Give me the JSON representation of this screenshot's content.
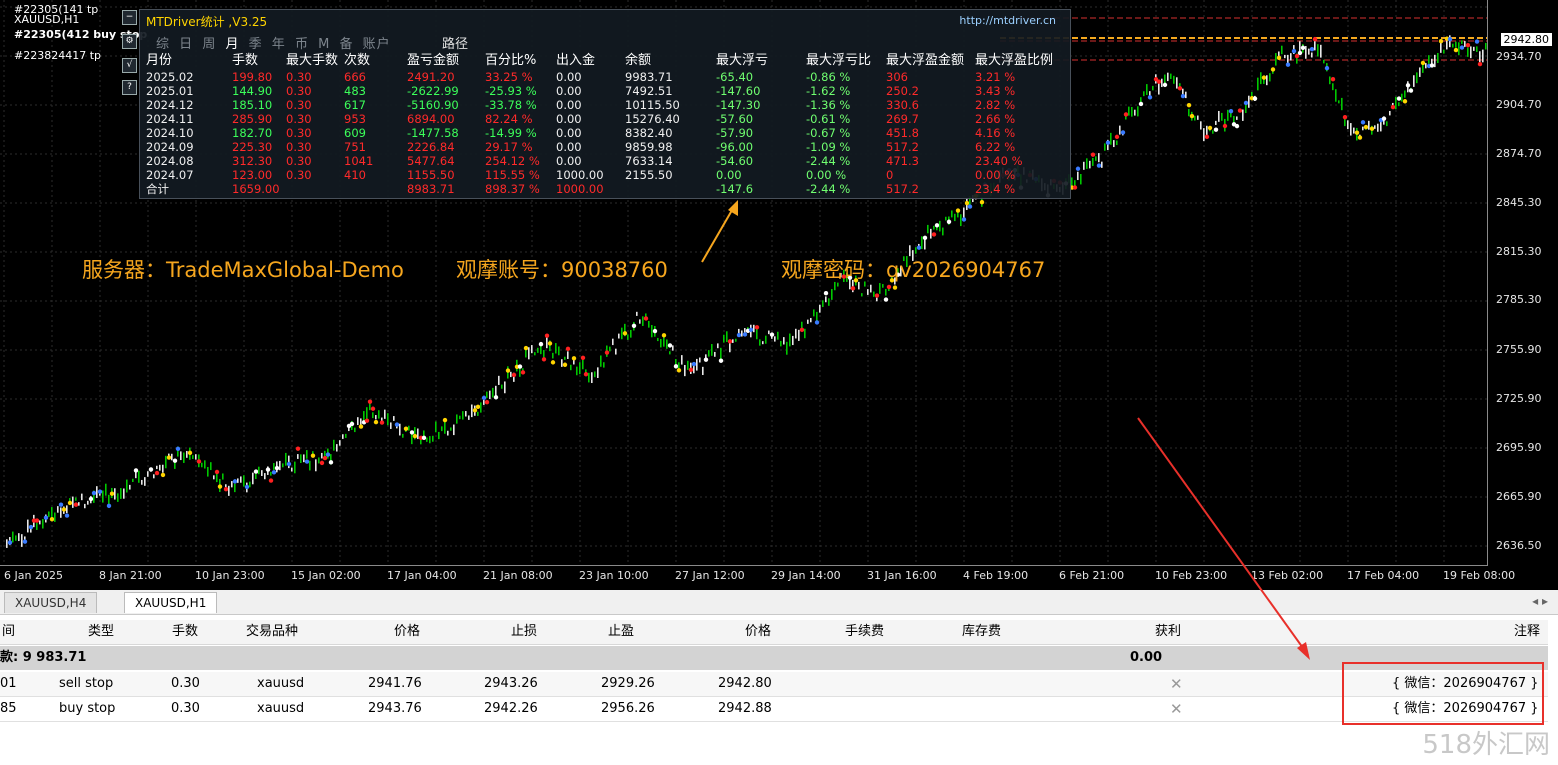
{
  "chart": {
    "symbol_labels": [
      "#22305(141 tp",
      "XAUUSD,H1",
      "#22305(412 buy stop",
      "#223824417 tp"
    ],
    "price_ticks": [
      "2934.70",
      "2904.70",
      "2874.70",
      "2845.30",
      "2815.30",
      "2785.30",
      "2755.90",
      "2725.90",
      "2695.90",
      "2665.90",
      "2636.50"
    ],
    "current_price": "2942.80",
    "time_ticks": [
      "6 Jan 2025",
      "8 Jan 21:00",
      "10 Jan 23:00",
      "15 Jan 02:00",
      "17 Jan 04:00",
      "21 Jan 08:00",
      "23 Jan 10:00",
      "27 Jan 12:00",
      "29 Jan 14:00",
      "31 Jan 16:00",
      "4 Feb 19:00",
      "6 Feb 21:00",
      "10 Feb 23:00",
      "13 Feb 02:00",
      "17 Feb 04:00",
      "19 Feb 08:00"
    ],
    "overlay": {
      "server": "服务器：TradeMaxGlobal-Demo",
      "account": "观摩账号：90038760",
      "password": "观摩密码：qv2026904767"
    },
    "colors": {
      "up": "#00c800",
      "down": "#ff2020",
      "level_red": "#d62f2f",
      "level_orange": "#f4a81e"
    }
  },
  "panel": {
    "title": "MTDriver统计 ,V3.25",
    "url": "http://mtdriver.cn",
    "tabs": [
      "综",
      "日",
      "周",
      "月",
      "季",
      "年",
      "币",
      "M",
      "备",
      "账户"
    ],
    "active_tab": "月",
    "path_label": "路径",
    "headers": [
      "月份",
      "手数",
      "最大手数",
      "次数",
      "盈亏金额",
      "百分比%",
      "出入金",
      "余额",
      "最大浮亏",
      "最大浮亏比",
      "最大浮盈金额",
      "最大浮盈比例"
    ],
    "rows": [
      [
        "2025.02",
        "199.80",
        "0.30",
        "666",
        "2491.20",
        "33.25 %",
        "0.00",
        "9983.71",
        "-65.40",
        "-0.86 %",
        "306",
        "3.21 %"
      ],
      [
        "2025.01",
        "144.90",
        "0.30",
        "483",
        "-2622.99",
        "-25.93 %",
        "0.00",
        "7492.51",
        "-147.60",
        "-1.62 %",
        "250.2",
        "3.43 %"
      ],
      [
        "2024.12",
        "185.10",
        "0.30",
        "617",
        "-5160.90",
        "-33.78 %",
        "0.00",
        "10115.50",
        "-147.30",
        "-1.36 %",
        "330.6",
        "2.82 %"
      ],
      [
        "2024.11",
        "285.90",
        "0.30",
        "953",
        "6894.00",
        "82.24 %",
        "0.00",
        "15276.40",
        "-57.60",
        "-0.61 %",
        "269.7",
        "2.66 %"
      ],
      [
        "2024.10",
        "182.70",
        "0.30",
        "609",
        "-1477.58",
        "-14.99 %",
        "0.00",
        "8382.40",
        "-57.90",
        "-0.67 %",
        "451.8",
        "4.16 %"
      ],
      [
        "2024.09",
        "225.30",
        "0.30",
        "751",
        "2226.84",
        "29.17 %",
        "0.00",
        "9859.98",
        "-96.00",
        "-1.09 %",
        "517.2",
        "6.22 %"
      ],
      [
        "2024.08",
        "312.30",
        "0.30",
        "1041",
        "5477.64",
        "254.12 %",
        "0.00",
        "7633.14",
        "-54.60",
        "-2.44 %",
        "471.3",
        "23.40 %"
      ],
      [
        "2024.07",
        "123.00",
        "0.30",
        "410",
        "1155.50",
        "115.55 %",
        "1000.00",
        "2155.50",
        "0.00",
        "0.00 %",
        "0",
        "0.00 %"
      ]
    ],
    "total": [
      "合计",
      "1659.00",
      "",
      "",
      "8983.71",
      "898.37 %",
      "1000.00",
      "",
      "-147.6",
      "-2.44 %",
      "517.2",
      "23.4 %"
    ]
  },
  "tabs": [
    "XAUUSD,H4",
    "XAUUSD,H1"
  ],
  "active_tab": "XAUUSD,H1",
  "orders": {
    "headers": [
      "间",
      "类型",
      "手数",
      "交易品种",
      "价格",
      "止损",
      "止盈",
      "价格",
      "手续费",
      "库存费",
      "获利",
      "注释"
    ],
    "balance_label": "款: 9 983.71",
    "balance_profit": "0.00",
    "rows": [
      {
        "id": "01",
        "type": "sell stop",
        "lots": "0.30",
        "symbol": "xauusd",
        "price": "2941.76",
        "sl": "2943.26",
        "tp": "2929.26",
        "current": "2942.80",
        "comment": "{ 微信：2026904767 }"
      },
      {
        "id": "85",
        "type": "buy stop",
        "lots": "0.30",
        "symbol": "xauusd",
        "price": "2943.76",
        "sl": "2942.26",
        "tp": "2956.26",
        "current": "2942.88",
        "comment": "{ 微信：2026904767 }"
      }
    ]
  },
  "watermark": "518外汇网"
}
